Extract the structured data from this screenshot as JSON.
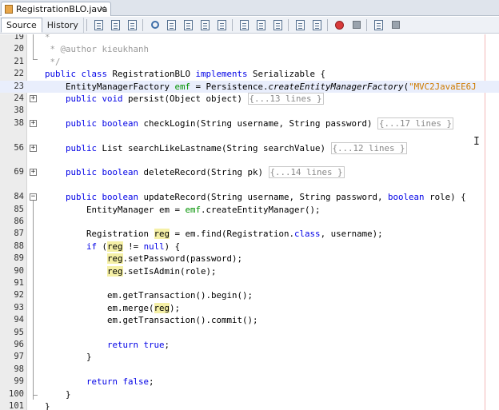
{
  "tab": {
    "file_name": "RegistrationBLO.java",
    "close": "×"
  },
  "toolbar": {
    "source_label": "Source",
    "history_label": "History",
    "icons": [
      "go-to-source-icon",
      "back-icon",
      "forward-icon",
      "find-icon",
      "find-previous-icon",
      "find-next-icon",
      "find-selection-icon",
      "toggle-highlight-icon",
      "shift-left-icon",
      "shift-right-icon",
      "toggle-comment-icon",
      "uncomment-icon",
      "start-macro-icon",
      "stop-macro-icon",
      "chart-icon",
      "sort-icon"
    ]
  },
  "editor": {
    "lines": [
      {
        "n": "19",
        "html": "<span class=\"cm\">*</span>"
      },
      {
        "n": "20",
        "html": "<span class=\"cm\"> * @author kieukhanh</span>"
      },
      {
        "n": "21",
        "html": "<span class=\"cm\"> */</span>"
      },
      {
        "n": "22",
        "html": "<span class=\"kw\">public class</span> RegistrationBLO <span class=\"kw\">implements</span> Serializable {"
      },
      {
        "n": "23",
        "html": "    EntityManagerFactory <span class=\"fld\">emf</span> = Persistence.<span class=\"it\">createEntityManagerFactory</span>(<span class=\"str\">\"MVC2JavaEE6J</span>",
        "hl": true
      },
      {
        "n": "24",
        "html": "    <span class=\"kw\">public void</span> persist(Object object) <span class=\"collapsed\">{...13 lines }</span>",
        "fold": "+"
      },
      {
        "n": "38",
        "html": ""
      },
      {
        "n": "38",
        "html": "    <span class=\"kw\">public boolean</span> checkLogin(String username, String password) <span class=\"collapsed\">{...17 lines }</span>",
        "fold": "+"
      },
      {
        "n": "",
        "html": ""
      },
      {
        "n": "56",
        "html": "    <span class=\"kw\">public</span> List searchLikeLastname(String searchValue) <span class=\"collapsed\">{...12 lines }</span>",
        "fold": "+"
      },
      {
        "n": "",
        "html": ""
      },
      {
        "n": "69",
        "html": "    <span class=\"kw\">public boolean</span> deleteRecord(String pk) <span class=\"collapsed\">{...14 lines }</span>",
        "fold": "+"
      },
      {
        "n": "",
        "html": ""
      },
      {
        "n": "84",
        "html": "    <span class=\"kw\">public boolean</span> updateRecord(String username, String password, <span class=\"kw\">boolean</span> role) {",
        "fold": "-"
      },
      {
        "n": "85",
        "html": "        EntityManager em = <span class=\"fld\">emf</span>.createEntityManager();"
      },
      {
        "n": "86",
        "html": ""
      },
      {
        "n": "87",
        "html": "        Registration <span class=\"mk\">reg</span> = em.find(Registration.<span class=\"kw\">class</span>, username);"
      },
      {
        "n": "88",
        "html": "        <span class=\"kw\">if</span> (<span class=\"mk\">reg</span> != <span class=\"kw\">null</span>) {"
      },
      {
        "n": "89",
        "html": "            <span class=\"mk\">reg</span>.setPassword(password);"
      },
      {
        "n": "90",
        "html": "            <span class=\"mk\">reg</span>.setIsAdmin(role);"
      },
      {
        "n": "91",
        "html": ""
      },
      {
        "n": "92",
        "html": "            em.getTransaction().begin();"
      },
      {
        "n": "93",
        "html": "            em.merge(<span class=\"mk\">reg</span>);"
      },
      {
        "n": "94",
        "html": "            em.getTransaction().commit();"
      },
      {
        "n": "95",
        "html": ""
      },
      {
        "n": "96",
        "html": "            <span class=\"kw\">return true</span>;"
      },
      {
        "n": "97",
        "html": "        }"
      },
      {
        "n": "98",
        "html": ""
      },
      {
        "n": "99",
        "html": "        <span class=\"kw\">return false</span>;"
      },
      {
        "n": "100",
        "html": "    }"
      },
      {
        "n": "101",
        "html": "}"
      }
    ]
  }
}
